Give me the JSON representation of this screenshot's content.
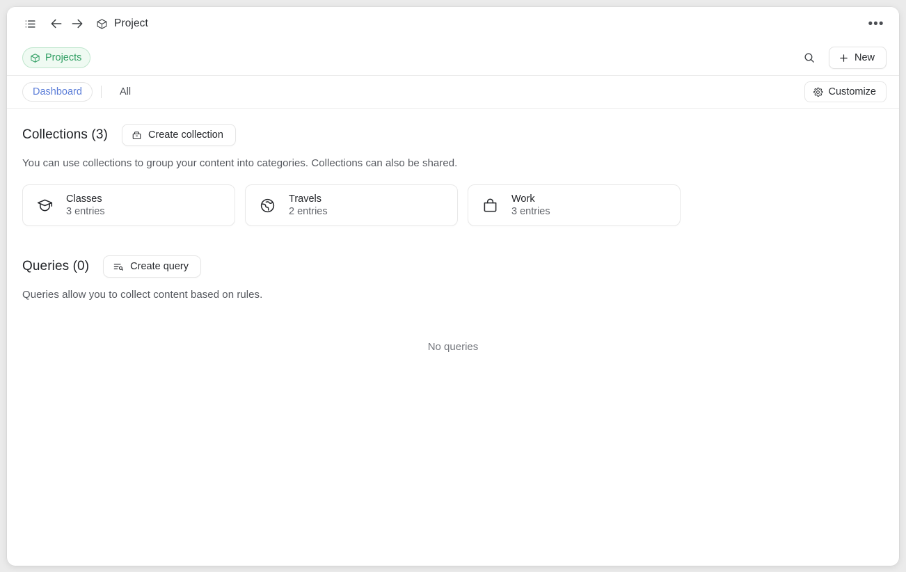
{
  "titlebar": {
    "sidebar_toggle_icon": "list-icon",
    "back_icon": "arrow-left-icon",
    "forward_icon": "arrow-right-icon",
    "title_icon": "box-icon",
    "title": "Project",
    "overflow_label": "•••"
  },
  "breadcrumb": {
    "icon": "box-icon",
    "label": "Projects",
    "search_icon": "search-icon",
    "new_label": "New",
    "new_icon": "plus-icon",
    "accent_color": "#2f9e62",
    "accent_bg": "#effaf2",
    "accent_border": "#bfe6cd"
  },
  "tabs": {
    "items": [
      {
        "label": "Dashboard",
        "active": true
      },
      {
        "label": "All",
        "active": false
      }
    ],
    "active_color": "#5b7dd8",
    "customize_label": "Customize",
    "customize_icon": "gear-icon"
  },
  "collections": {
    "title": "Collections (3)",
    "create_label": "Create collection",
    "create_icon": "archive-box-icon",
    "description": "You can use collections to group your content into categories. Collections can also be shared.",
    "cards": [
      {
        "icon": "graduation-cap-icon",
        "title": "Classes",
        "subtitle": "3 entries"
      },
      {
        "icon": "globe-icon",
        "title": "Travels",
        "subtitle": "2 entries"
      },
      {
        "icon": "briefcase-icon",
        "title": "Work",
        "subtitle": "3 entries"
      }
    ]
  },
  "queries": {
    "title": "Queries (0)",
    "create_label": "Create query",
    "create_icon": "list-search-icon",
    "description": "Queries allow you to collect content based on rules.",
    "empty_text": "No queries"
  }
}
